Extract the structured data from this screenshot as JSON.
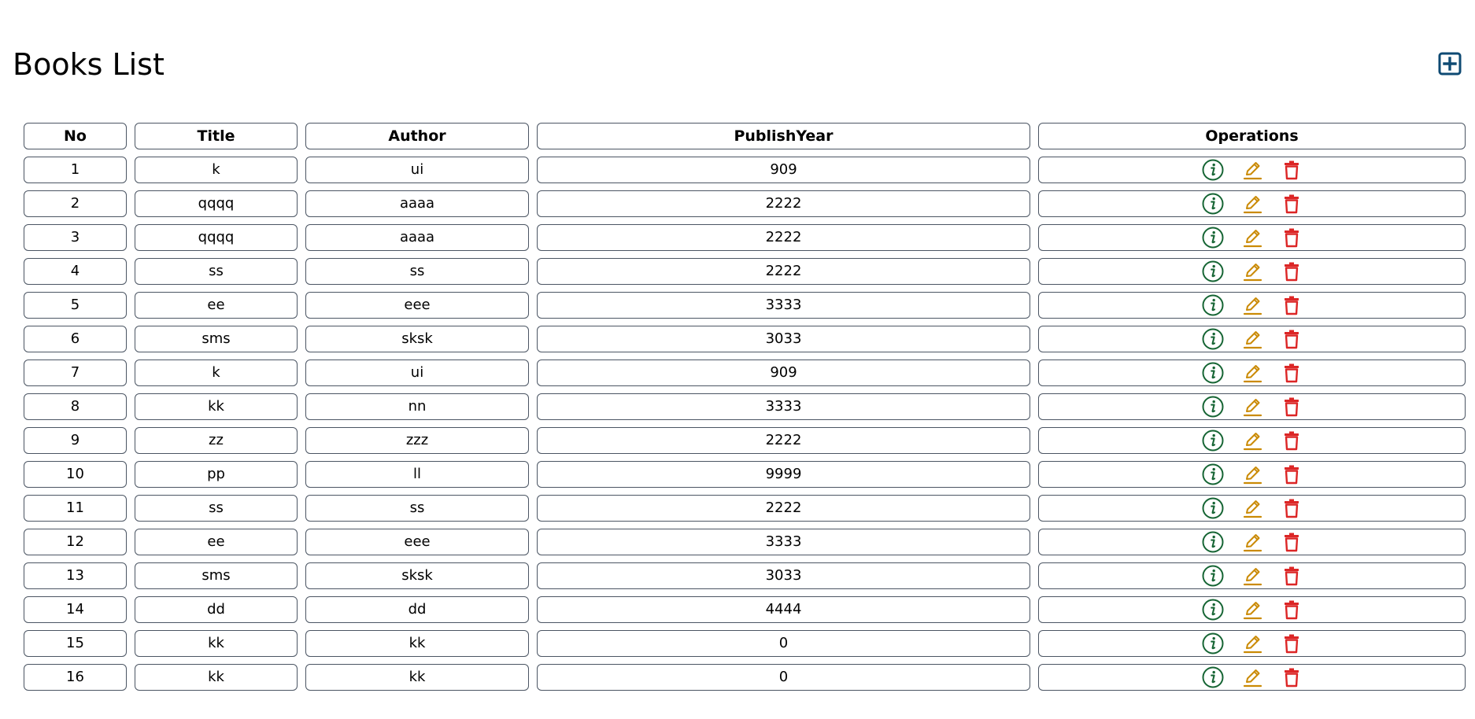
{
  "page": {
    "title": "Books List"
  },
  "icons": {
    "add": "plus-square-icon",
    "info": "info-circle-icon",
    "edit": "pencil-icon",
    "delete": "trash-icon"
  },
  "colors": {
    "add": "#0e4a73",
    "info": "#166534",
    "edit": "#ca8a04",
    "delete": "#dc2626",
    "border": "#4b5563"
  },
  "table": {
    "headers": {
      "no": "No",
      "title": "Title",
      "author": "Author",
      "publish_year": "PublishYear",
      "operations": "Operations"
    },
    "rows": [
      {
        "no": "1",
        "title": "k",
        "author": "ui",
        "publish_year": "909"
      },
      {
        "no": "2",
        "title": "qqqq",
        "author": "aaaa",
        "publish_year": "2222"
      },
      {
        "no": "3",
        "title": "qqqq",
        "author": "aaaa",
        "publish_year": "2222"
      },
      {
        "no": "4",
        "title": "ss",
        "author": "ss",
        "publish_year": "2222"
      },
      {
        "no": "5",
        "title": "ee",
        "author": "eee",
        "publish_year": "3333"
      },
      {
        "no": "6",
        "title": "sms",
        "author": "sksk",
        "publish_year": "3033"
      },
      {
        "no": "7",
        "title": "k",
        "author": "ui",
        "publish_year": "909"
      },
      {
        "no": "8",
        "title": "kk",
        "author": "nn",
        "publish_year": "3333"
      },
      {
        "no": "9",
        "title": "zz",
        "author": "zzz",
        "publish_year": "2222"
      },
      {
        "no": "10",
        "title": "pp",
        "author": "ll",
        "publish_year": "9999"
      },
      {
        "no": "11",
        "title": "ss",
        "author": "ss",
        "publish_year": "2222"
      },
      {
        "no": "12",
        "title": "ee",
        "author": "eee",
        "publish_year": "3333"
      },
      {
        "no": "13",
        "title": "sms",
        "author": "sksk",
        "publish_year": "3033"
      },
      {
        "no": "14",
        "title": "dd",
        "author": "dd",
        "publish_year": "4444"
      },
      {
        "no": "15",
        "title": "kk",
        "author": "kk",
        "publish_year": "0"
      },
      {
        "no": "16",
        "title": "kk",
        "author": "kk",
        "publish_year": "0"
      }
    ]
  }
}
